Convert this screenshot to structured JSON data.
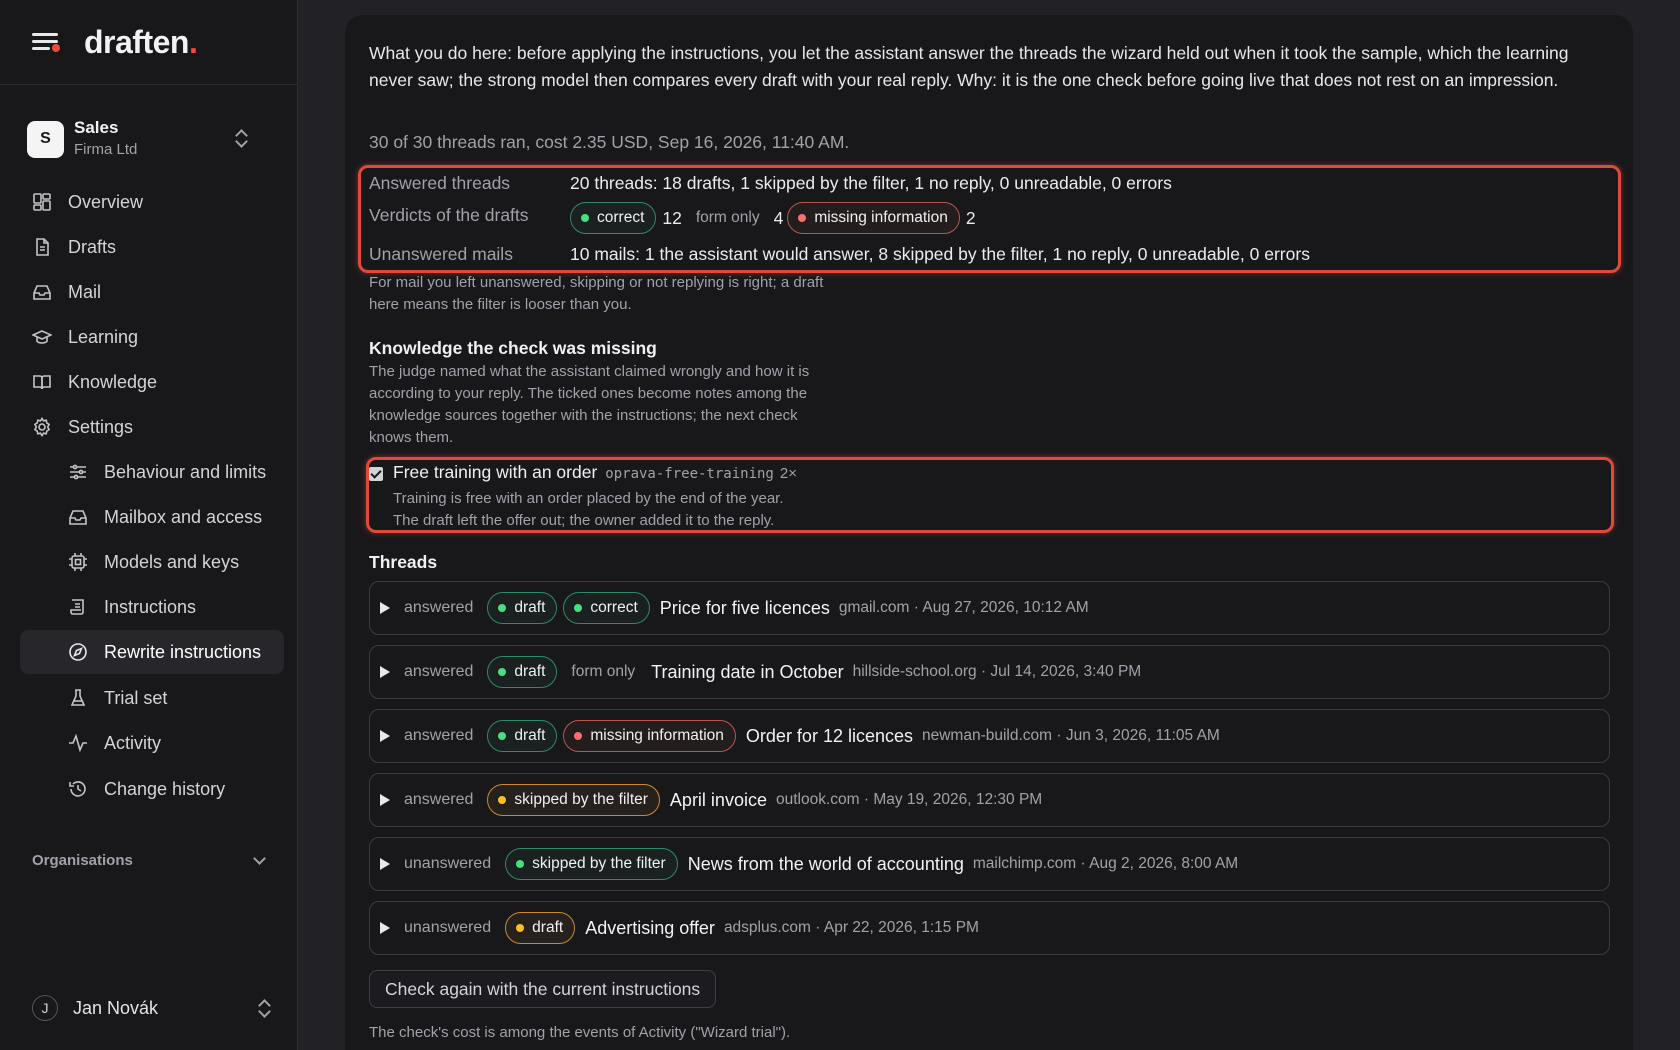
{
  "brand": {
    "name": "draften",
    "dot": "."
  },
  "org": {
    "initial": "S",
    "name": "Sales",
    "company": "Firma Ltd"
  },
  "nav": [
    {
      "label": "Overview",
      "icon": "dashboard-icon"
    },
    {
      "label": "Drafts",
      "icon": "document-icon"
    },
    {
      "label": "Mail",
      "icon": "inbox-icon"
    },
    {
      "label": "Learning",
      "icon": "graduation-cap-icon"
    },
    {
      "label": "Knowledge",
      "icon": "book-icon"
    },
    {
      "label": "Settings",
      "icon": "gear-icon"
    },
    {
      "label": "Behaviour and limits",
      "icon": "sliders-icon"
    },
    {
      "label": "Mailbox and access",
      "icon": "inbox-icon"
    },
    {
      "label": "Models and keys",
      "icon": "chip-icon"
    },
    {
      "label": "Instructions",
      "icon": "script-icon"
    },
    {
      "label": "Rewrite instructions",
      "icon": "compass-icon",
      "active": true
    },
    {
      "label": "Trial set",
      "icon": "flask-icon"
    },
    {
      "label": "Activity",
      "icon": "activity-icon"
    },
    {
      "label": "Change history",
      "icon": "history-icon"
    }
  ],
  "organisations_label": "Organisations",
  "user": {
    "initial": "J",
    "name": "Jan Novák"
  },
  "intro": "What you do here: before applying the instructions, you let the assistant answer the threads the wizard held out when it took the sample, which the learning never saw; the strong model then compares every draft with your real reply. Why: it is the one check before going live that does not rest on an impression.",
  "run_info": "30 of 30 threads ran, cost 2.35 USD, Sep 16, 2026, 11:40 AM.",
  "stats": {
    "answered_label": "Answered threads",
    "answered_value": "20 threads: 18 drafts, 1 skipped by the filter, 1 no reply, 0 unreadable, 0 errors",
    "verdicts_label": "Verdicts of the drafts",
    "verdicts": {
      "correct": "correct",
      "correct_count": "12",
      "form_only": "form only",
      "form_only_count": "4",
      "missing": "missing information",
      "missing_count": "2"
    },
    "unanswered_label": "Unanswered mails",
    "unanswered_value": "10 mails: 1 the assistant would answer, 8 skipped by the filter, 1 no reply, 0 unreadable, 0 errors"
  },
  "unanswered_note_1": "For mail you left unanswered, skipping or not replying is right; a draft",
  "unanswered_note_2": "here means the filter is looser than you.",
  "knowledge": {
    "heading": "Knowledge the check was missing",
    "desc_1": "The judge named what the assistant claimed wrongly and how it is",
    "desc_2": "according to your reply. The ticked ones become notes among the",
    "desc_3": "knowledge sources together with the instructions; the next check",
    "desc_4": "knows them.",
    "item": {
      "title": "Free training with an order",
      "code": "oprava-free-training",
      "count": "2×",
      "line_1": "Training is free with an order placed by the end of the year.",
      "line_2": "The draft left the offer out; the owner added it to the reply."
    }
  },
  "threads_heading": "Threads",
  "threads": [
    {
      "state": "answered",
      "tags": [
        "draft",
        "correct"
      ],
      "title": "Price for five licences",
      "meta": "gmail.com · Aug 27, 2026, 10:12 AM"
    },
    {
      "state": "answered",
      "tags": [
        "draft",
        "form only"
      ],
      "title": "Training date in October",
      "meta": "hillside-school.org · Jul 14, 2026, 3:40 PM"
    },
    {
      "state": "answered",
      "tags": [
        "draft",
        "missing information"
      ],
      "title": "Order for 12 licences",
      "meta": "newman-build.com · Jun 3, 2026, 11:05 AM"
    },
    {
      "state": "answered",
      "tags": [
        "skipped by the filter"
      ],
      "title": "April invoice",
      "meta": "outlook.com · May 19, 2026, 12:30 PM"
    },
    {
      "state": "unanswered",
      "tags": [
        "skipped by the filter"
      ],
      "title": "News from the world of accounting",
      "meta": "mailchimp.com · Aug 2, 2026, 8:00 AM"
    },
    {
      "state": "unanswered",
      "tags": [
        "draft"
      ],
      "title": "Advertising offer",
      "meta": "adsplus.com · Apr 22, 2026, 1:15 PM"
    }
  ],
  "check_button": "Check again with the current instructions",
  "footnote": "The check's cost is among the events of Activity (\"Wizard trial\").",
  "colors": {
    "accent": "#ef4b3c",
    "green": "#2f8a6c",
    "red": "#b8574e",
    "orange": "#c98a2e"
  }
}
